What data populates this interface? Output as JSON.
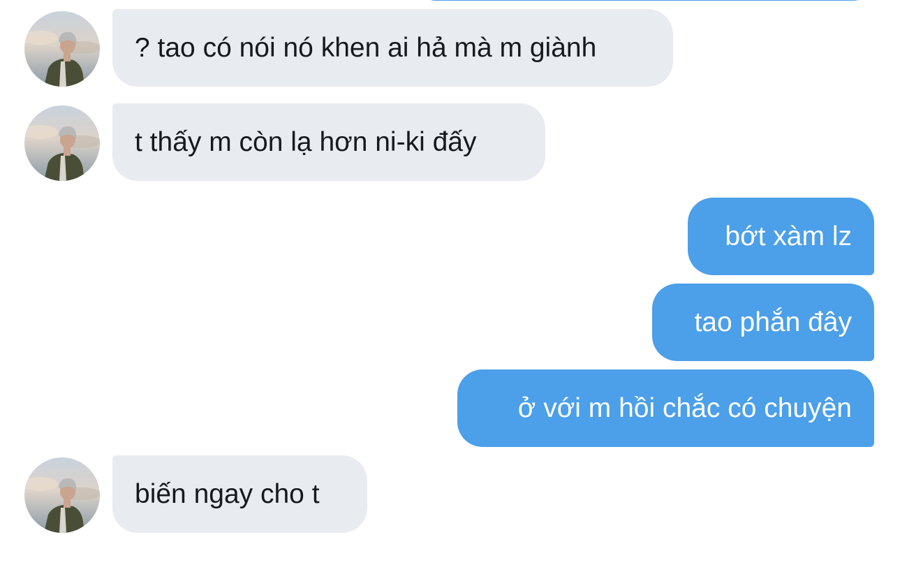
{
  "conversation": {
    "messages": [
      {
        "direction": "incoming",
        "text": "? tao có nói nó khen ai hả mà m giành"
      },
      {
        "direction": "incoming",
        "text": "t thấy m còn lạ hơn ni-ki đấy"
      },
      {
        "direction": "outgoing",
        "text": "bớt xàm lz"
      },
      {
        "direction": "outgoing",
        "text": "tao phắn đây"
      },
      {
        "direction": "outgoing",
        "text": "ở với m hồi chắc có chuyện"
      },
      {
        "direction": "incoming",
        "text": "biến ngay cho t"
      }
    ]
  },
  "theme": {
    "incoming_bubble": "#e8ebf0",
    "incoming_text": "#161a1f",
    "outgoing_bubble": "#4c9fe9",
    "outgoing_text": "#ffffff"
  },
  "avatar_icon": "contact-photo-person-looking-up"
}
